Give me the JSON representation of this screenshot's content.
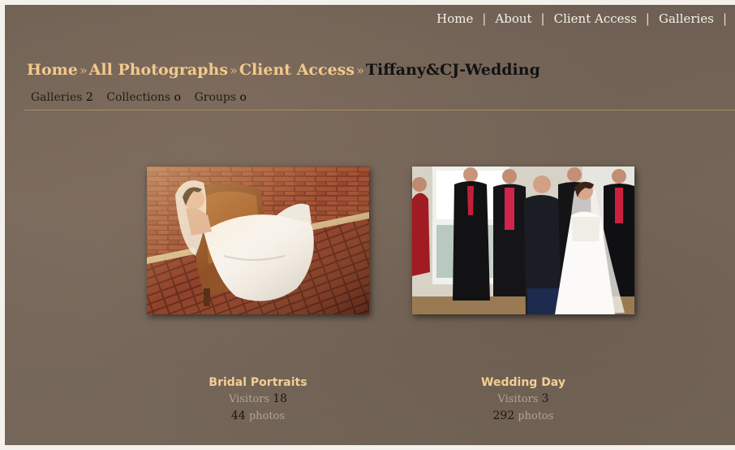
{
  "top_nav": {
    "items": [
      "Home",
      "About",
      "Client Access",
      "Galleries"
    ],
    "separator": "|"
  },
  "breadcrumb": {
    "links": [
      "Home",
      "All Photographs",
      "Client Access"
    ],
    "separator": "»",
    "current": "Tiffany&CJ-Wedding"
  },
  "counts": {
    "galleries_label": "Galleries",
    "galleries_value": "2",
    "collections_label": "Collections",
    "collections_value": "o",
    "groups_label": "Groups",
    "groups_value": "o"
  },
  "galleries": [
    {
      "title": "Bridal Portraits",
      "visitors_label": "Visitors",
      "visitors_value": "18",
      "photos_value": "44",
      "photos_label": "photos"
    },
    {
      "title": "Wedding Day",
      "visitors_label": "Visitors",
      "visitors_value": "3",
      "photos_value": "292",
      "photos_label": "photos"
    }
  ],
  "colors": {
    "background": "#76675a",
    "link_gold": "#f2c98c",
    "divider": "#a98c63",
    "nav_text": "#f6f1ea"
  }
}
